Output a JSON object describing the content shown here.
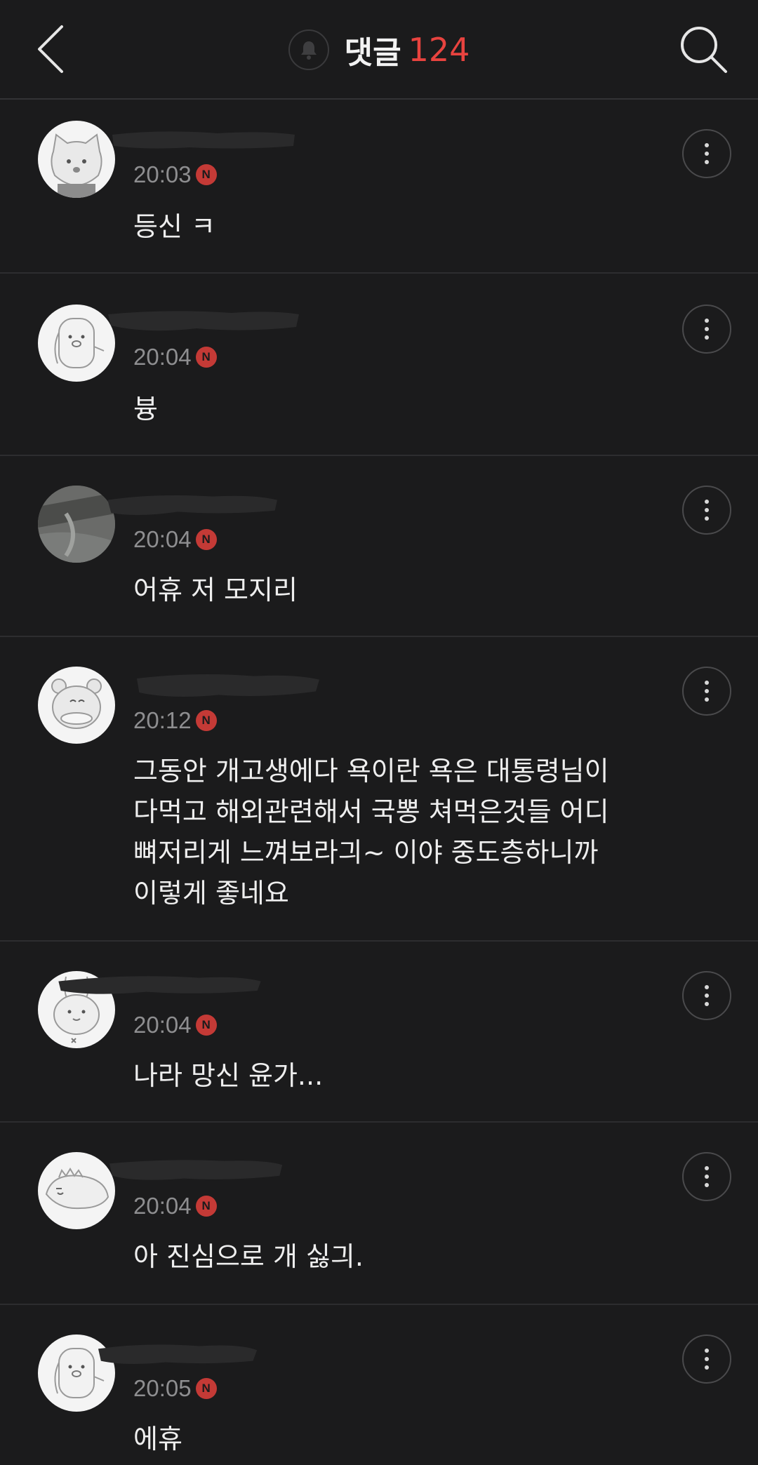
{
  "header": {
    "title": "댓글",
    "count": "124",
    "back_icon": "chevron-left-icon",
    "bell_icon": "bell-icon",
    "search_icon": "search-icon"
  },
  "badge": {
    "new_label": "N",
    "color": "#c43a36"
  },
  "accent_color": "#e8433f",
  "comments": [
    {
      "time": "20:03",
      "text": "등신 ㅋ",
      "avatar": "cat-avatar-icon"
    },
    {
      "time": "20:04",
      "text": "븅",
      "avatar": "pig-avatar-icon"
    },
    {
      "time": "20:04",
      "text": "어휴 저 모지리",
      "avatar": "photo-avatar"
    },
    {
      "time": "20:12",
      "text": "그동안 개고생에다 욕이란 욕은 대통령님이\n다먹고 해외관련해서 국뽕 쳐먹은것들 어디\n뼈저리게 느껴보라긔~ 이야 중도층하니까\n이렇게 좋네요",
      "avatar": "bear-avatar-icon"
    },
    {
      "time": "20:04",
      "text": "나라 망신 윤가...",
      "avatar": "rabbit-avatar-icon"
    },
    {
      "time": "20:04",
      "text": "아 진심으로 개 싫긔.",
      "avatar": "dino-avatar-icon"
    },
    {
      "time": "20:05",
      "text": "에휴",
      "avatar": "pig-avatar-icon"
    }
  ]
}
